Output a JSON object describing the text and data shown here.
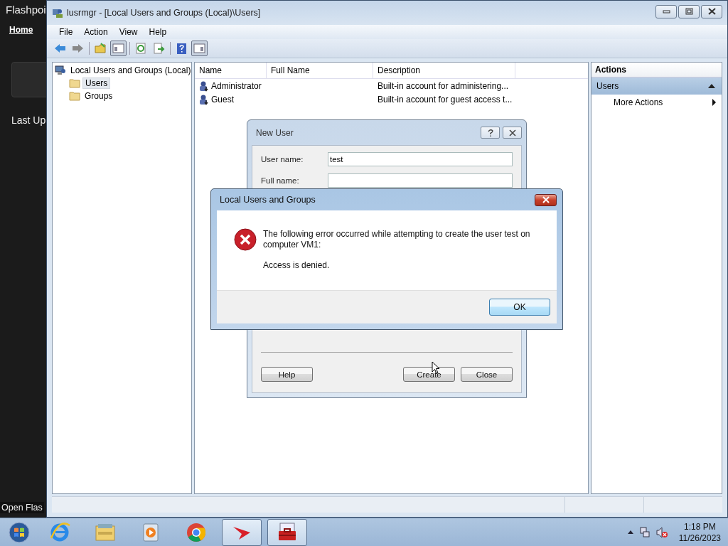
{
  "background_app": {
    "title": "Flashpoi",
    "nav": [
      {
        "label": "Home",
        "selected": true
      }
    ],
    "section": "Last Up",
    "footer": "Open Flas"
  },
  "window": {
    "title": "lusrmgr - [Local Users and Groups (Local)\\Users]",
    "menu": [
      "File",
      "Action",
      "View",
      "Help"
    ]
  },
  "tree": {
    "label": "Local Users and Groups (Local)",
    "children": [
      {
        "label": "Users",
        "selected": true
      },
      {
        "label": "Groups",
        "selected": false
      }
    ]
  },
  "list": {
    "columns": [
      "Name",
      "Full Name",
      "Description"
    ],
    "rows": [
      {
        "name": "Administrator",
        "description": "Built-in account for administering..."
      },
      {
        "name": "Guest",
        "description": "Built-in account for guest access t..."
      }
    ]
  },
  "actions": {
    "title": "Actions",
    "section": "Users",
    "items": [
      "More Actions"
    ]
  },
  "new_user_dialog": {
    "title": "New User",
    "fields": [
      {
        "label": "User name:",
        "value": "test"
      },
      {
        "label": "Full name:"
      }
    ],
    "buttons": [
      "Help",
      "Create",
      "Close"
    ]
  },
  "error_dialog": {
    "title": "Local Users and Groups",
    "message": "The following error occurred while attempting to create the user test on computer VM1:",
    "detail": "Access is denied.",
    "button": "OK"
  },
  "taskbar": {
    "apps": [
      {
        "kind": "ie",
        "selected": false
      },
      {
        "kind": "explorer",
        "selected": false
      },
      {
        "kind": "media",
        "selected": false
      },
      {
        "kind": "chrome",
        "selected": false
      },
      {
        "kind": "arrow",
        "selected": true
      },
      {
        "kind": "toolbox",
        "selected": true
      }
    ],
    "clock": {
      "time": "1:18 PM",
      "date": "11/26/2023"
    }
  }
}
